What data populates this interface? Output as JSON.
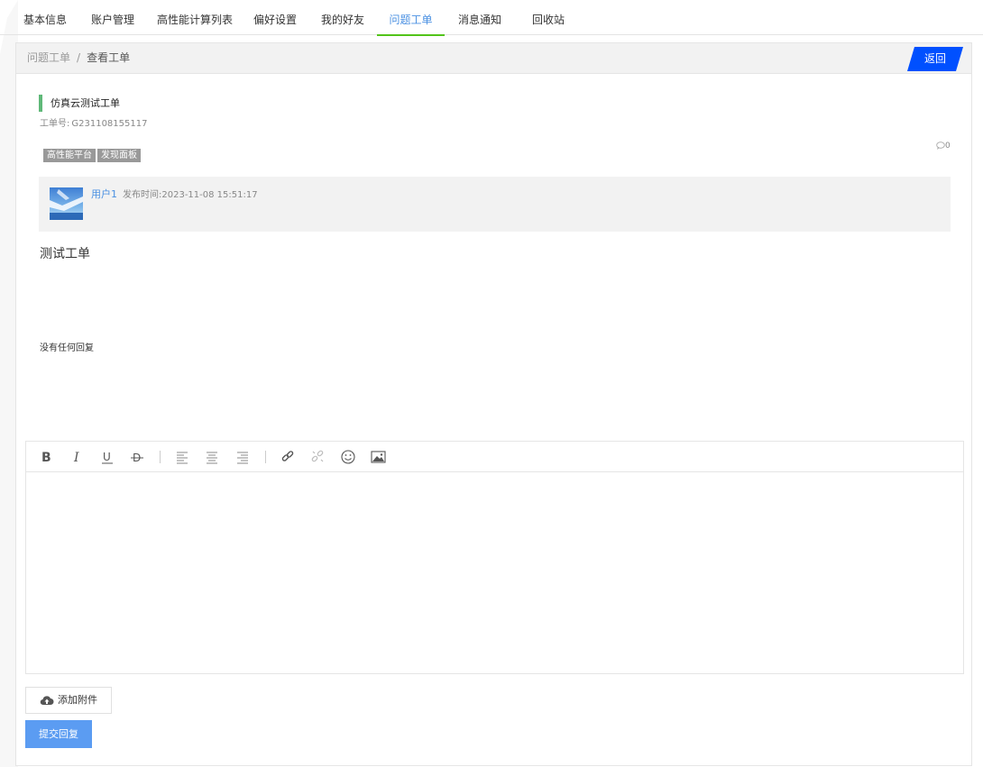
{
  "tabs": [
    {
      "label": "基本信息"
    },
    {
      "label": "账户管理"
    },
    {
      "label": "高性能计算列表"
    },
    {
      "label": "偏好设置"
    },
    {
      "label": "我的好友"
    },
    {
      "label": "问题工单"
    },
    {
      "label": "消息通知"
    },
    {
      "label": "回收站"
    }
  ],
  "active_tab": "问题工单",
  "breadcrumb": {
    "parent": "问题工单",
    "separator": "/",
    "current": "查看工单"
  },
  "back_label": "返回",
  "ticket": {
    "title": "仿真云测试工单",
    "number_label": "工单号:",
    "number": "G231108155117",
    "tags": [
      "高性能平台",
      "发现面板"
    ],
    "comment_count": "0",
    "author": "用户1",
    "publish_label": "发布时间:",
    "publish_time": "2023-11-08 15:51:17",
    "content": "测试工单",
    "no_reply": "没有任何回复"
  },
  "editor": {
    "tools": [
      "bold-icon",
      "italic-icon",
      "underline-icon",
      "strikethrough-icon",
      "align-left-icon",
      "align-center-icon",
      "align-right-icon",
      "link-icon",
      "unlink-icon",
      "emoji-icon",
      "image-icon"
    ]
  },
  "attach_label": "添加附件",
  "submit_label": "提交回复",
  "colors": {
    "accent": "#4a90e2",
    "active_underline": "#52c41a",
    "back_button": "#0050ff",
    "submit": "#5b9cf2",
    "title_bar": "#5fb878"
  }
}
